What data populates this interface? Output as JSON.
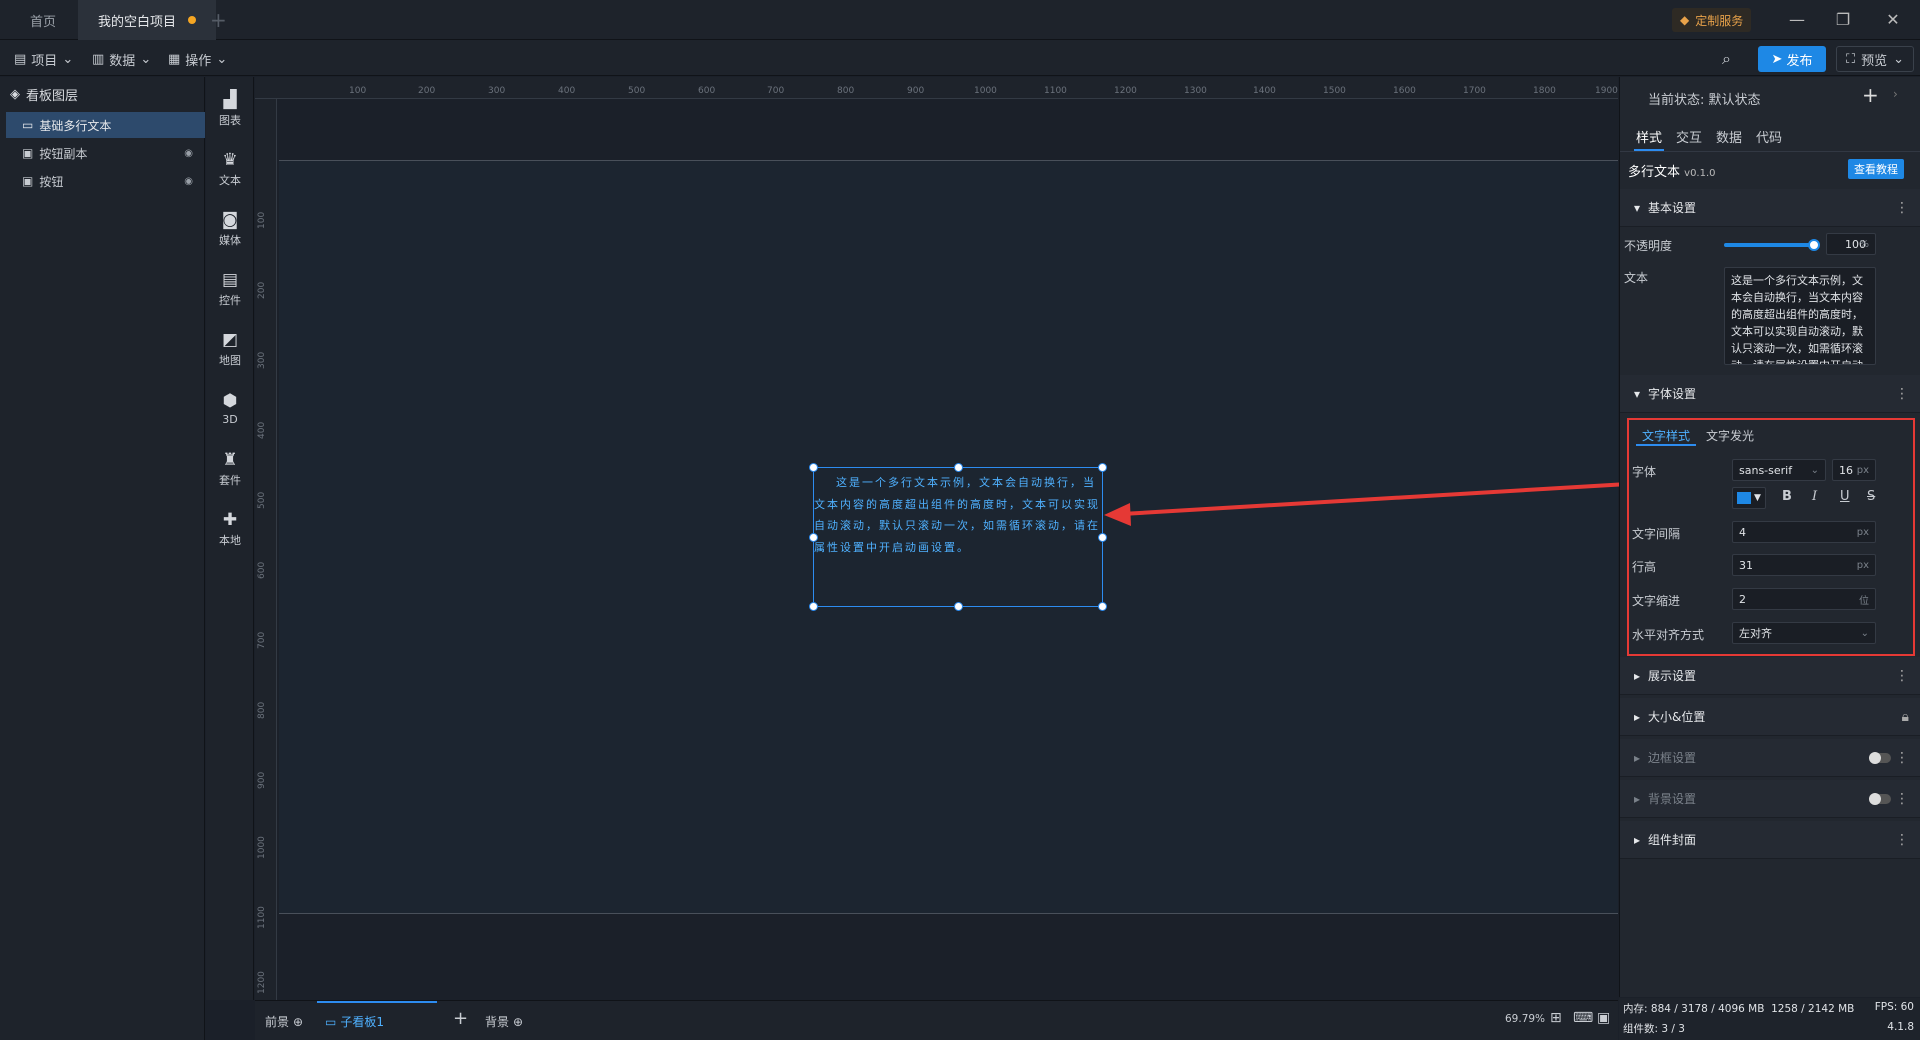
{
  "titlebar": {
    "tabs": [
      {
        "label": "首页"
      },
      {
        "label": "我的空白项目"
      }
    ],
    "custom_service": "定制服务"
  },
  "menubar": {
    "items": [
      {
        "label": "项目"
      },
      {
        "label": "数据"
      },
      {
        "label": "操作"
      }
    ],
    "publish": "发布",
    "preview": "预览"
  },
  "layers": {
    "title": "看板图层",
    "items": [
      {
        "label": "基础多行文本"
      },
      {
        "label": "按钮副本"
      },
      {
        "label": "按钮"
      }
    ]
  },
  "tools": [
    {
      "label": "图表"
    },
    {
      "label": "文本"
    },
    {
      "label": "媒体"
    },
    {
      "label": "控件"
    },
    {
      "label": "地图"
    },
    {
      "label": "3D"
    },
    {
      "label": "套件"
    },
    {
      "label": "本地"
    }
  ],
  "ruler": {
    "top": [
      "100",
      "200",
      "300",
      "400",
      "500",
      "600",
      "700",
      "800",
      "900",
      "1000",
      "1100",
      "1200",
      "1300",
      "1400",
      "1500",
      "1600",
      "1700",
      "1800",
      "1900"
    ],
    "left": [
      "100",
      "200",
      "300",
      "400",
      "500",
      "600",
      "700",
      "800",
      "900",
      "1000",
      "1100",
      "1200"
    ]
  },
  "canvas": {
    "text_content": "这是一个多行文本示例，文本会自动换行，当文本内容的高度超出组件的高度时，文本可以实现自动滚动，默认只滚动一次，如需循环滚动，请在属性设置中开启动画设置。"
  },
  "bottombar": {
    "foreground": "前景",
    "subboard": "子看板1",
    "background": "背景",
    "zoom": "69.79%"
  },
  "panel": {
    "state_label": "当前状态:",
    "state_value": "默认状态",
    "tabs": [
      {
        "label": "样式"
      },
      {
        "label": "交互"
      },
      {
        "label": "数据"
      },
      {
        "label": "代码"
      }
    ],
    "component_name": "多行文本",
    "version": "v0.1.0",
    "tutorial": "查看教程",
    "basic": {
      "title": "基本设置",
      "opacity_label": "不透明度",
      "opacity_value": "100",
      "opacity_unit": "%",
      "opacity_fraction": 1.0,
      "text_label": "文本",
      "text_value": "这是一个多行文本示例，文本会自动换行，当文本内容的高度超出组件的高度时，文本可以实现自动滚动，默认只滚动一次，如需循环滚动，请在属性设置中开启动画设置。"
    },
    "font": {
      "title": "字体设置",
      "subtabs": [
        {
          "label": "文字样式"
        },
        {
          "label": "文字发光"
        }
      ],
      "font_label": "字体",
      "font_value": "sans-serif",
      "size_value": "16",
      "size_unit": "px",
      "color": "#1e88e5",
      "bold": "B",
      "italic": "I",
      "underline": "U",
      "strike": "S",
      "spacing_label": "文字间隔",
      "spacing_value": "4",
      "spacing_unit": "px",
      "lineheight_label": "行高",
      "lineheight_value": "31",
      "lineheight_unit": "px",
      "indent_label": "文字缩进",
      "indent_value": "2",
      "indent_unit": "位",
      "align_label": "水平对齐方式",
      "align_value": "左对齐"
    },
    "sections": [
      {
        "label": "展示设置"
      },
      {
        "label": "大小&位置"
      },
      {
        "label": "边框设置"
      },
      {
        "label": "背景设置"
      },
      {
        "label": "组件封面"
      }
    ]
  },
  "status": {
    "memory_label": "内存:",
    "memory_value": "884 / 3178 / 4096 MB",
    "memory_value2": "1258 / 2142 MB",
    "fps_label": "FPS:",
    "fps_value": "60",
    "components_label": "组件数:",
    "components_value": "3 / 3",
    "version": "4.1.8"
  },
  "colors": {
    "accent": "#1e88e5",
    "annotation": "#e53935",
    "selected_text": "#4fb1ff"
  }
}
